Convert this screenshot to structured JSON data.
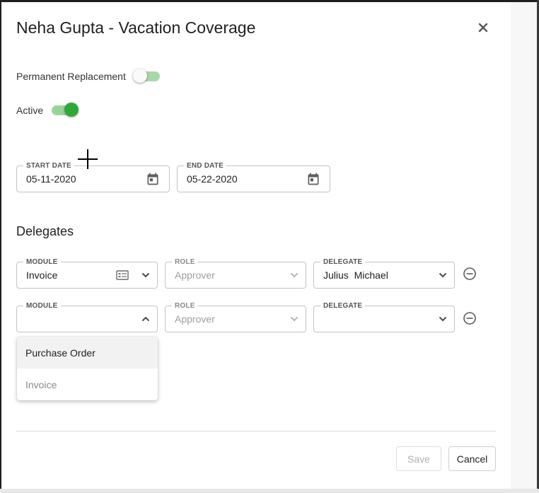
{
  "dialog": {
    "title": "Neha Gupta - Vacation Coverage"
  },
  "toggles": {
    "permanent_replacement": {
      "label": "Permanent Replacement",
      "on": false
    },
    "active": {
      "label": "Active",
      "on": true
    }
  },
  "dates": {
    "start": {
      "label": "START DATE",
      "value": "05-11-2020"
    },
    "end": {
      "label": "END DATE",
      "value": "05-22-2020"
    }
  },
  "delegates": {
    "heading": "Delegates",
    "rows": [
      {
        "module": {
          "label": "MODULE",
          "value": "Invoice"
        },
        "role": {
          "label": "ROLE",
          "value": "Approver"
        },
        "delegate": {
          "label": "DELEGATE",
          "value": "Julius  Michael"
        }
      },
      {
        "module": {
          "label": "MODULE",
          "value": ""
        },
        "role": {
          "label": "ROLE",
          "value": "Approver"
        },
        "delegate": {
          "label": "DELEGATE",
          "value": ""
        }
      }
    ]
  },
  "module_dropdown": {
    "options": [
      "Purchase Order",
      "Invoice"
    ]
  },
  "footer": {
    "save_label": "Save",
    "cancel_label": "Cancel"
  },
  "colors": {
    "toggle_on": "#2fa83a",
    "toggle_track": "#a8d8a8"
  },
  "icons": {
    "close": "close-icon",
    "calendar": "calendar-icon",
    "chevron_down": "chevron-down-icon",
    "chevron_up": "chevron-up-icon",
    "module_list": "list-card-icon",
    "remove": "remove-circle-icon"
  }
}
